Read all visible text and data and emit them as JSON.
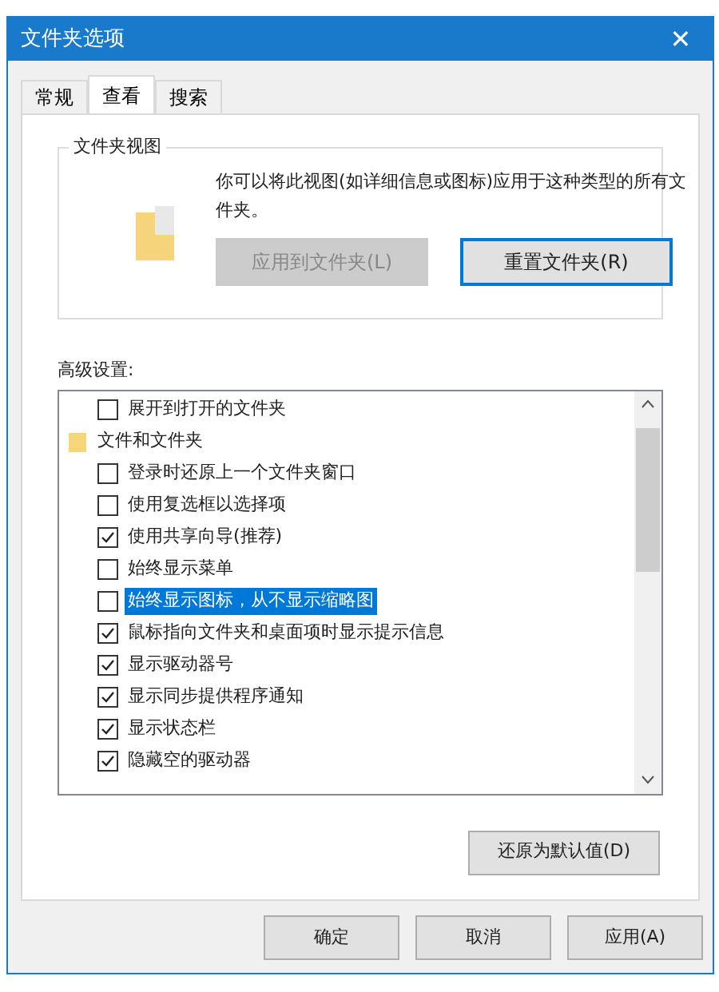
{
  "window": {
    "title": "文件夹选项",
    "close": "✕"
  },
  "tabs": [
    {
      "label": "常规",
      "selected": false
    },
    {
      "label": "查看",
      "selected": true
    },
    {
      "label": "搜索",
      "selected": false
    }
  ],
  "folder_views": {
    "title": "文件夹视图",
    "description": "你可以将此视图(如详细信息或图标)应用于这种类型的所有文件夹。",
    "buttons": [
      {
        "label": "应用到文件夹(L)",
        "disabled": true
      },
      {
        "label": "重置文件夹(R)",
        "disabled": false
      }
    ]
  },
  "advanced": {
    "label": "高级设置:",
    "items": [
      {
        "kind": "checkbox",
        "label": "展开到打开的文件夹",
        "checked": false,
        "selected": false
      },
      {
        "kind": "folder",
        "label": "文件和文件夹",
        "selected": false
      },
      {
        "kind": "checkbox",
        "label": "登录时还原上一个文件夹窗口",
        "checked": false,
        "selected": false
      },
      {
        "kind": "checkbox",
        "label": "使用复选框以选择项",
        "checked": false,
        "selected": false
      },
      {
        "kind": "checkbox",
        "label": "使用共享向导(推荐)",
        "checked": true,
        "selected": false
      },
      {
        "kind": "checkbox",
        "label": "始终显示菜单",
        "checked": false,
        "selected": false
      },
      {
        "kind": "checkbox",
        "label": "始终显示图标，从不显示缩略图",
        "checked": false,
        "selected": true
      },
      {
        "kind": "checkbox",
        "label": "鼠标指向文件夹和桌面项时显示提示信息",
        "checked": true,
        "selected": false
      },
      {
        "kind": "checkbox",
        "label": "显示驱动器号",
        "checked": true,
        "selected": false
      },
      {
        "kind": "checkbox",
        "label": "显示同步提供程序通知",
        "checked": true,
        "selected": false
      },
      {
        "kind": "checkbox",
        "label": "显示状态栏",
        "checked": true,
        "selected": false
      },
      {
        "kind": "checkbox",
        "label": "隐藏空的驱动器",
        "checked": true,
        "selected": false
      }
    ],
    "restore_button": "还原为默认值(D)"
  },
  "buttons": [
    "确定",
    "取消",
    "应用(A)"
  ]
}
